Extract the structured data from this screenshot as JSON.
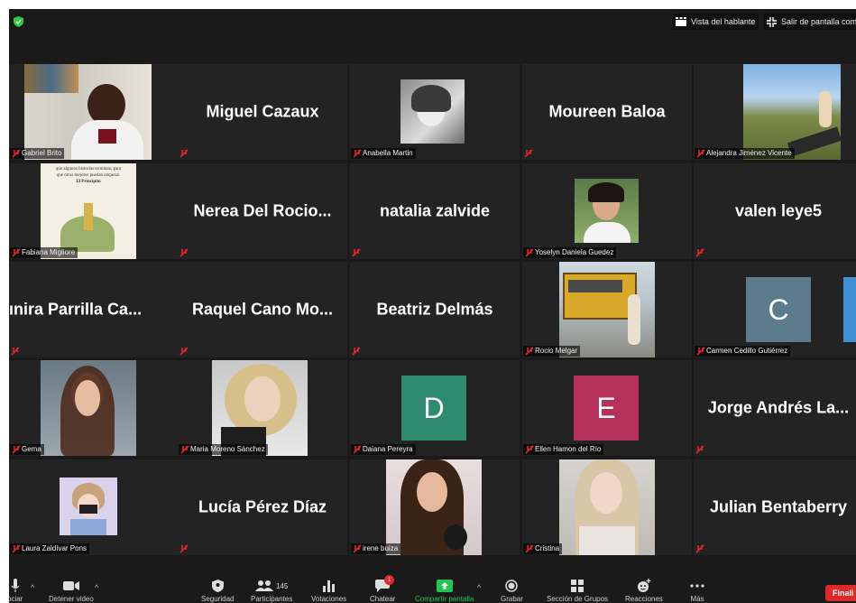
{
  "topbar": {
    "speaker_view": "Vista del hablante",
    "exit_fullscreen": "Salir de pantalla comp"
  },
  "tiles": [
    {
      "name": "Gabriel Brito",
      "display": "",
      "kind": "video"
    },
    {
      "name": "",
      "display": "Miguel Cazaux",
      "kind": "name"
    },
    {
      "name": "Anabella Martin",
      "display": "",
      "kind": "video"
    },
    {
      "name": "",
      "display": "Moureen Baloa",
      "kind": "name"
    },
    {
      "name": "Alejandra Jiménez Vicente",
      "display": "",
      "kind": "video"
    },
    {
      "name": "Fabiana Migliore",
      "display": "",
      "kind": "video"
    },
    {
      "name": "",
      "display": "Nerea Del Rocio...",
      "kind": "name"
    },
    {
      "name": "",
      "display": "natalia zalvide",
      "kind": "name"
    },
    {
      "name": "Yoselyn Daniela Guedez",
      "display": "",
      "kind": "video"
    },
    {
      "name": "",
      "display": "valen leye5",
      "kind": "name"
    },
    {
      "name": "",
      "display": "ınira Parrilla Ca...",
      "kind": "name"
    },
    {
      "name": "",
      "display": "Raquel Cano Mo...",
      "kind": "name"
    },
    {
      "name": "",
      "display": "Beatriz Delmás",
      "kind": "name"
    },
    {
      "name": "Rocio Melgar",
      "display": "",
      "kind": "video"
    },
    {
      "name": "Carmen Cedillo Gutiérrez",
      "display": "",
      "kind": "letter",
      "letter": "C",
      "color": "#5c7b8c"
    },
    {
      "name": "Gema",
      "display": "",
      "kind": "video"
    },
    {
      "name": "Maria Moreno Sánchez",
      "display": "",
      "kind": "video"
    },
    {
      "name": "Daiana Pereyra",
      "display": "",
      "kind": "letter",
      "letter": "D",
      "color": "#2e8b6e"
    },
    {
      "name": "Ellen Hamon del Río",
      "display": "",
      "kind": "letter",
      "letter": "E",
      "color": "#b5305a"
    },
    {
      "name": "",
      "display": "Jorge Andrés La...",
      "kind": "name"
    },
    {
      "name": "Laura Zaldívar Pons",
      "display": "",
      "kind": "video"
    },
    {
      "name": "",
      "display": "Lucía Pérez Díaz",
      "kind": "name"
    },
    {
      "name": "irene buiza",
      "display": "",
      "kind": "video"
    },
    {
      "name": "Cristina",
      "display": "",
      "kind": "video"
    },
    {
      "name": "",
      "display": "Julian Bentaberry",
      "kind": "name"
    }
  ],
  "fabiana_book": {
    "line1": "que algunos historias terminan, para",
    "line2": "que otros mejores puedan empezar.",
    "line3": "El Principito"
  },
  "toolbar": {
    "unmute": "ociar",
    "stop_video": "Detener video",
    "security": "Seguridad",
    "participants": "Participantes",
    "participants_count": "145",
    "polls": "Votaciones",
    "chat": "Chatear",
    "chat_badge": "1",
    "share": "Compartir pantalla",
    "record": "Grabar",
    "breakout": "Sección de Grupos",
    "reactions": "Reacciones",
    "more": "Más",
    "finish": "Finali"
  },
  "colors": {
    "background": "#1a1a1a",
    "tile": "#232323",
    "share_green": "#23c552",
    "mute_red": "#e02828",
    "finish_red": "#e02828"
  }
}
